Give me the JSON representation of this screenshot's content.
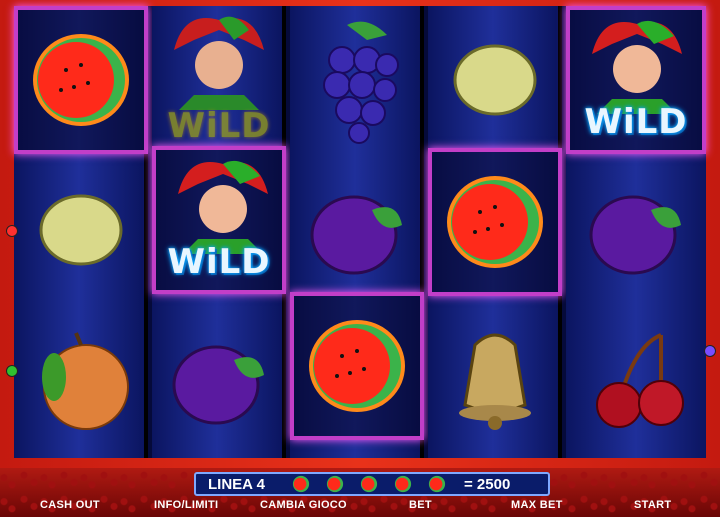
{
  "reels": [
    [
      "watermelon",
      "lemon",
      "orange"
    ],
    [
      "wild",
      "wild",
      "plum"
    ],
    [
      "grapes",
      "plum",
      "watermelon"
    ],
    [
      "lemon",
      "watermelon",
      "bell"
    ],
    [
      "wild",
      "plum",
      "cherries"
    ]
  ],
  "wild_label": "WiLD",
  "win_line": {
    "label": "LINEA 4",
    "symbols": [
      "watermelon",
      "watermelon",
      "watermelon",
      "watermelon",
      "watermelon"
    ],
    "payout": "= 2500"
  },
  "buttons": {
    "cash_out": "CASH OUT",
    "info": "INFO/LIMITI",
    "change_game": "CAMBIA GIOCO",
    "bet": "BET",
    "max_bet": "MAX BET",
    "start": "START"
  },
  "colors": {
    "win_highlight": "#c23ec8",
    "frame": "#e8321a",
    "reel_bg": "#1f2f9a"
  }
}
